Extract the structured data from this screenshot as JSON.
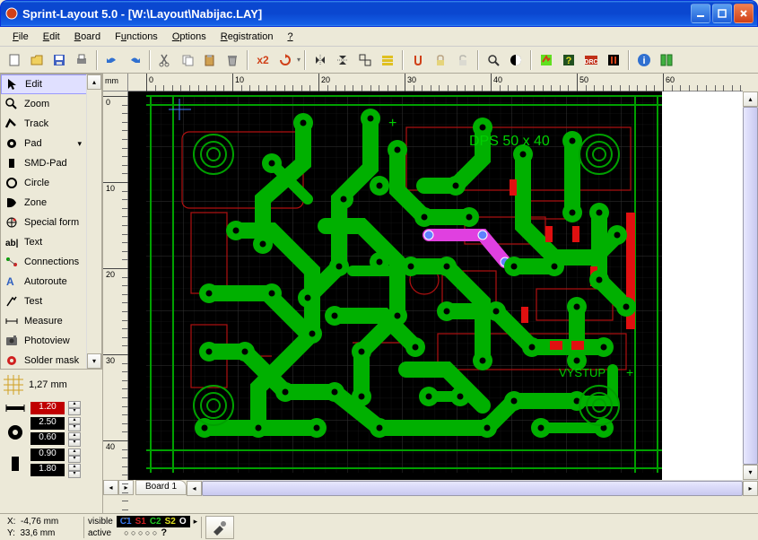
{
  "window": {
    "title": "Sprint-Layout 5.0 - [W:\\Layout\\Nabijac.LAY]"
  },
  "menu": {
    "file": "File",
    "edit": "Edit",
    "board": "Board",
    "functions": "Functions",
    "options": "Options",
    "registration": "Registration",
    "help": "?"
  },
  "toolbar": {
    "new": "New",
    "open": "Open",
    "save": "Save",
    "print": "Print",
    "undo": "Undo",
    "redo": "Redo",
    "cut": "Cut",
    "copy": "Copy",
    "paste": "Paste",
    "delete": "Delete",
    "x2": "x2",
    "rotate": "Rotate",
    "mirror_h": "MirrorH",
    "mirror_v": "MirrorV",
    "group": "Group",
    "align": "Align",
    "snap": "Snap",
    "lock_a": "Lock",
    "lock_b": "Lock2",
    "zoom": "Zoom",
    "contrast": "Contrast",
    "highlighter": "Highlight",
    "help_q": "Help",
    "drc": "DRC",
    "measure": "Measure",
    "info": "Info",
    "panel": "Panel"
  },
  "tools": {
    "items": [
      {
        "icon": "cursor",
        "label": "Edit"
      },
      {
        "icon": "zoom",
        "label": "Zoom"
      },
      {
        "icon": "track",
        "label": "Track"
      },
      {
        "icon": "pad",
        "label": "Pad"
      },
      {
        "icon": "smd",
        "label": "SMD-Pad"
      },
      {
        "icon": "circle",
        "label": "Circle"
      },
      {
        "icon": "zone",
        "label": "Zone"
      },
      {
        "icon": "special",
        "label": "Special form"
      },
      {
        "icon": "text",
        "label": "Text"
      },
      {
        "icon": "conn",
        "label": "Connections"
      },
      {
        "icon": "autoroute",
        "label": "Autoroute"
      },
      {
        "icon": "test",
        "label": "Test"
      },
      {
        "icon": "measure",
        "label": "Measure"
      },
      {
        "icon": "photoview",
        "label": "Photoview"
      },
      {
        "icon": "soldermask",
        "label": "Solder mask"
      }
    ],
    "selected": 0
  },
  "grid": {
    "value": "1,27 mm"
  },
  "sizes": {
    "track": "1.20",
    "pad_outer": "2.50",
    "pad_inner": "0.60",
    "smd_w": "0.90",
    "smd_h": "1.80"
  },
  "ruler": {
    "unit": "mm",
    "h_ticks": [
      0,
      10,
      20,
      30,
      40,
      50,
      60
    ],
    "v_ticks": [
      0,
      10,
      20,
      30,
      40
    ]
  },
  "tab": {
    "label": "Board 1"
  },
  "status": {
    "x_label": "X:",
    "x_val": "-4,76 mm",
    "y_label": "Y:",
    "y_val": "33,6 mm",
    "visible": "visible",
    "active": "active",
    "layers": [
      "C1",
      "S1",
      "C2",
      "S2",
      "O"
    ]
  },
  "board": {
    "text1": "DPS 50 x 40",
    "text2": "VYSTUP"
  }
}
